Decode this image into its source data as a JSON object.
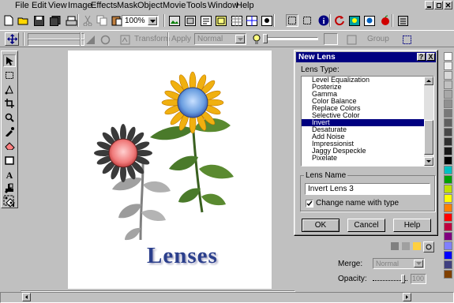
{
  "menubar": {
    "items": [
      "File",
      "Edit",
      "View",
      "Image",
      "Effects",
      "Mask",
      "Object",
      "Movie",
      "Tools",
      "Window",
      "Help"
    ]
  },
  "toolbar": {
    "zoom_value": "100%"
  },
  "attribute_bar": {
    "transform_label": "Transform",
    "apply_label": "Apply",
    "mode_value": "Normal",
    "group_label": "Group"
  },
  "canvas": {
    "heading": "Lenses"
  },
  "dialog": {
    "title": "New Lens",
    "help_btn": "?",
    "close_btn": "X",
    "lens_type_label": "Lens Type:",
    "lens_types": [
      "Level Equalization",
      "Posterize",
      "Gamma",
      "Color Balance",
      "Replace Colors",
      "Selective Color",
      "Invert",
      "Desaturate",
      "Add Noise",
      "Impressionist",
      "Jaggy Despeckle",
      "Pixelate"
    ],
    "selected_lens": "Invert",
    "lens_name_group": "Lens Name",
    "lens_name_value": "Invert Lens 3",
    "change_name_label": "Change name with type",
    "change_name_checked": true,
    "ok_label": "OK",
    "cancel_label": "Cancel",
    "help_label": "Help"
  },
  "objects_panel": {
    "merge_label": "Merge:",
    "merge_value": "Normal",
    "opacity_label": "Opacity:",
    "opacity_value": "100"
  },
  "colors": {
    "titlebar": "#000080",
    "heading": "#2b3f8c",
    "palette": [
      "#ffffff",
      "#f0f0f0",
      "#d8d8d8",
      "#c0c0c0",
      "#a8a8a8",
      "#909090",
      "#787878",
      "#606060",
      "#484848",
      "#303030",
      "#181818",
      "#000000",
      "#00c0c0",
      "#00a000",
      "#c0e000",
      "#ffff00",
      "#ff8000",
      "#ff0000",
      "#c00040",
      "#800080",
      "#8080ff",
      "#0000ff",
      "#404080",
      "#804000"
    ]
  }
}
